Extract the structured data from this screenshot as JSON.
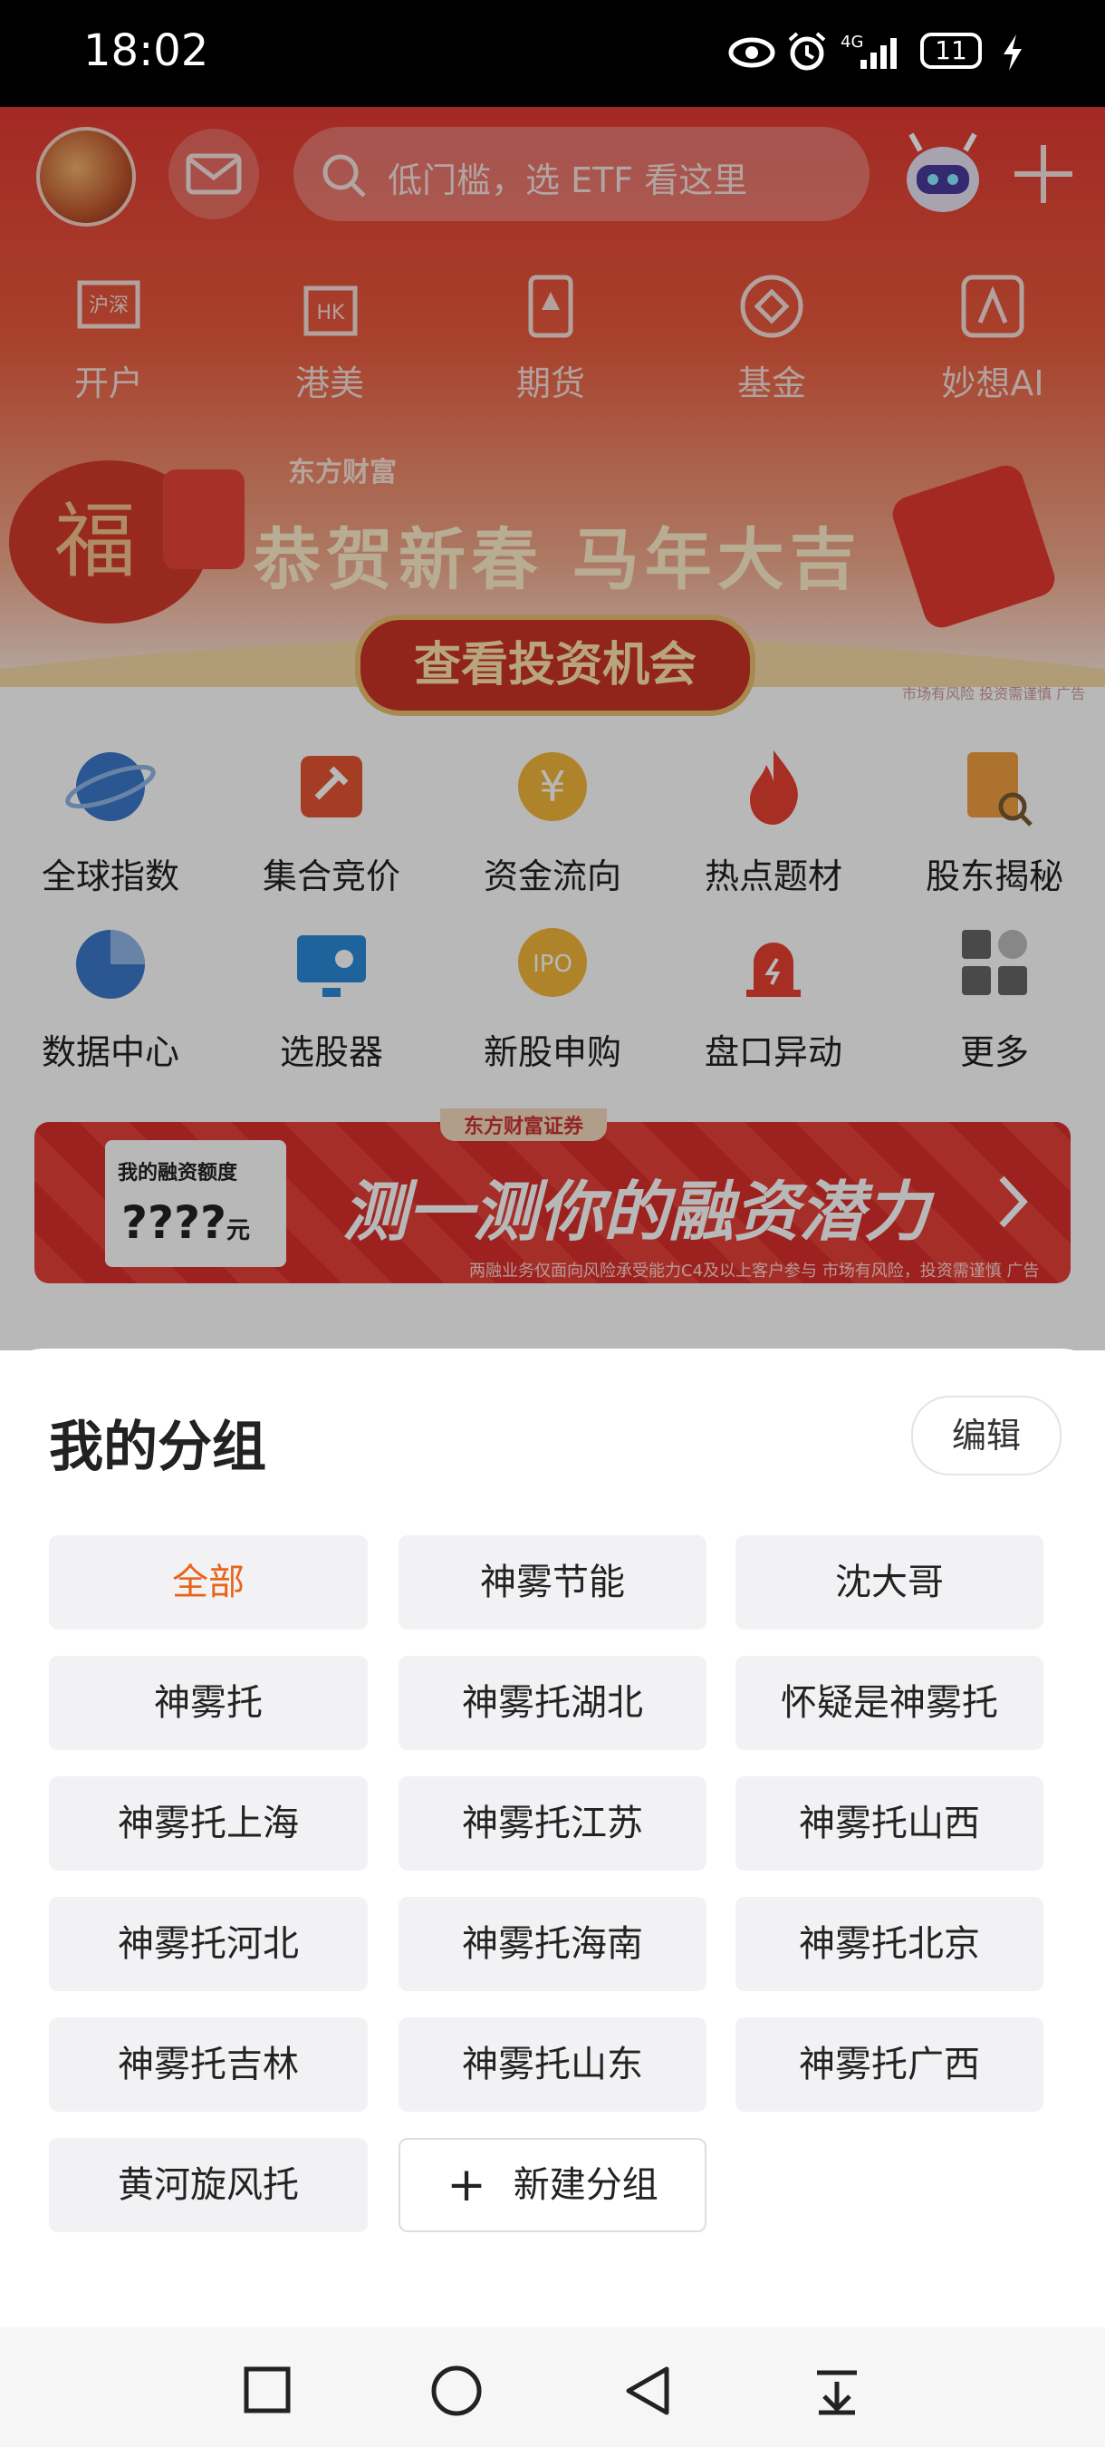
{
  "status_bar": {
    "time": "18:02",
    "network": "4G",
    "battery": "11"
  },
  "app": {
    "search_placeholder": "低门槛，选 ETF 看这里",
    "quick_nav": [
      {
        "label": "开户",
        "icon": "shanghai-shenzhen-icon"
      },
      {
        "label": "港美",
        "icon": "hk-icon"
      },
      {
        "label": "期货",
        "icon": "futures-icon"
      },
      {
        "label": "基金",
        "icon": "fund-icon"
      },
      {
        "label": "妙想AI",
        "icon": "ai-icon"
      }
    ],
    "banner": {
      "brand": "东方财富",
      "title": "恭贺新春 马年大吉",
      "button": "查看投资机会",
      "disclaimer": "市场有风险 投资需谨慎 广告"
    },
    "features": [
      {
        "label": "全球指数",
        "icon": "globe-icon",
        "color": "#3b78c9"
      },
      {
        "label": "集合竞价",
        "icon": "auction-icon",
        "color": "#e55533"
      },
      {
        "label": "资金流向",
        "icon": "yuan-flow-icon",
        "color": "#e5a020"
      },
      {
        "label": "热点题材",
        "icon": "flame-icon",
        "color": "#e84030"
      },
      {
        "label": "股东揭秘",
        "icon": "shareholder-icon",
        "color": "#e89a40"
      },
      {
        "label": "数据中心",
        "icon": "pie-chart-icon",
        "color": "#3b78c9"
      },
      {
        "label": "选股器",
        "icon": "stock-screener-icon",
        "color": "#2a8ad8"
      },
      {
        "label": "新股申购",
        "icon": "ipo-icon",
        "color": "#e8a020"
      },
      {
        "label": "盘口异动",
        "icon": "alarm-icon",
        "color": "#e84030"
      },
      {
        "label": "更多",
        "icon": "more-grid-icon",
        "color": "#888888"
      }
    ],
    "promo": {
      "brand": "东方财富证券",
      "card_title": "我的融资额度",
      "card_value": "????",
      "card_unit": "元",
      "title": "测一测你的融资潜力",
      "note": "两融业务仅面向风险承受能力C4及以上客户参与 市场有风险，投资需谨慎 广告"
    }
  },
  "sheet": {
    "title": "我的分组",
    "edit_label": "编辑",
    "groups": [
      "全部",
      "神雾节能",
      "沈大哥",
      "神雾托",
      "神雾托湖北",
      "怀疑是神雾托",
      "神雾托上海",
      "神雾托江苏",
      "神雾托山西",
      "神雾托河北",
      "神雾托海南",
      "神雾托北京",
      "神雾托吉林",
      "神雾托山东",
      "神雾托广西",
      "黄河旋风托"
    ],
    "active_group": "全部",
    "new_group_label": "新建分组",
    "accent_color": "#e8641b"
  }
}
